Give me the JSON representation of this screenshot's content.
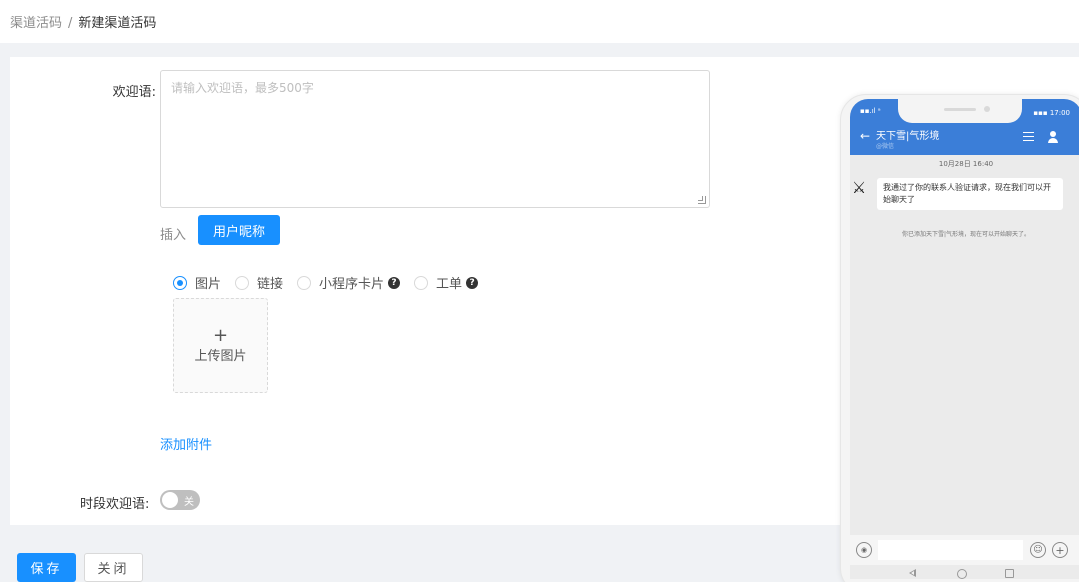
{
  "breadcrumb": {
    "parent": "渠道活码",
    "separator": "/",
    "current": "新建渠道活码"
  },
  "form": {
    "greeting_label": "欢迎语:",
    "greeting_placeholder": "请输入欢迎语，最多500字",
    "insert_label": "插入",
    "nickname_button": "用户昵称",
    "attachment_types": [
      {
        "label": "图片",
        "checked": true,
        "help": false
      },
      {
        "label": "链接",
        "checked": false,
        "help": false
      },
      {
        "label": "小程序卡片",
        "checked": false,
        "help": true
      },
      {
        "label": "工单",
        "checked": false,
        "help": true
      }
    ],
    "upload_plus": "+",
    "upload_label": "上传图片",
    "add_attachment": "添加附件",
    "timed_greeting_label": "时段欢迎语:",
    "switch_off_text": "关",
    "switch_on": false
  },
  "actions": {
    "save": "保存",
    "close": "关闭"
  },
  "phone": {
    "status_left": "▪▪.ıl ᵃ",
    "status_right": "▪▪▪ 17:00",
    "chat_title": "天下雪|气形境",
    "chat_subtitle": "@微信",
    "time": "10月28日 16:40",
    "message": "我通过了你的联系人验证请求，现在我们可以开始聊天了",
    "system_message": "你已添加天下雪|气形境，现在可以开始聊天了。"
  },
  "colors": {
    "primary": "#1890ff",
    "phone_header": "#3b7ed8",
    "page_bg": "#f0f2f5"
  }
}
